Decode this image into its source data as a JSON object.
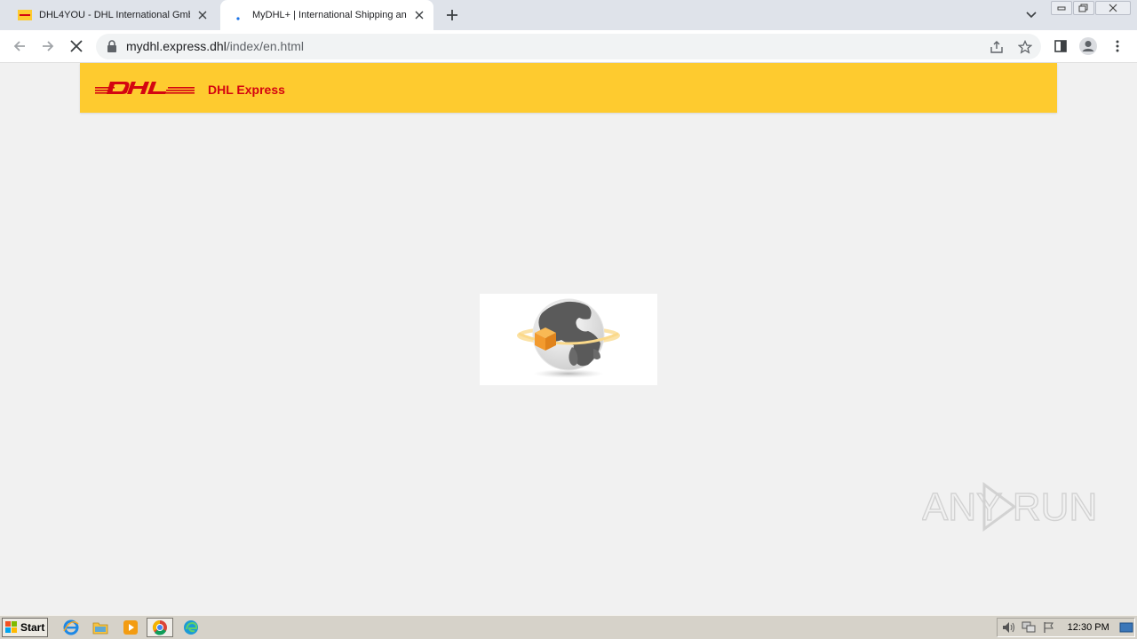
{
  "browser": {
    "tabs": [
      {
        "title": "DHL4YOU - DHL International GmbH",
        "active": false,
        "favicon": "dhl-favicon"
      },
      {
        "title": "MyDHL+ | International Shipping and",
        "active": true,
        "favicon": "loading-spinner-icon"
      }
    ],
    "url": {
      "host": "mydhl.express.dhl",
      "path": "/index/en.html"
    }
  },
  "page": {
    "header": {
      "brand_label": "DHL Express"
    },
    "loader": {
      "icon": "globe-package-loading-icon"
    }
  },
  "watermark": {
    "text": "ANY RUN"
  },
  "taskbar": {
    "start_label": "Start",
    "clock": "12:30 PM"
  },
  "colors": {
    "dhl_yellow": "#fecb2f",
    "dhl_red": "#d40511",
    "page_bg": "#f1f1f1",
    "tabstrip_bg": "#dfe3ea"
  }
}
